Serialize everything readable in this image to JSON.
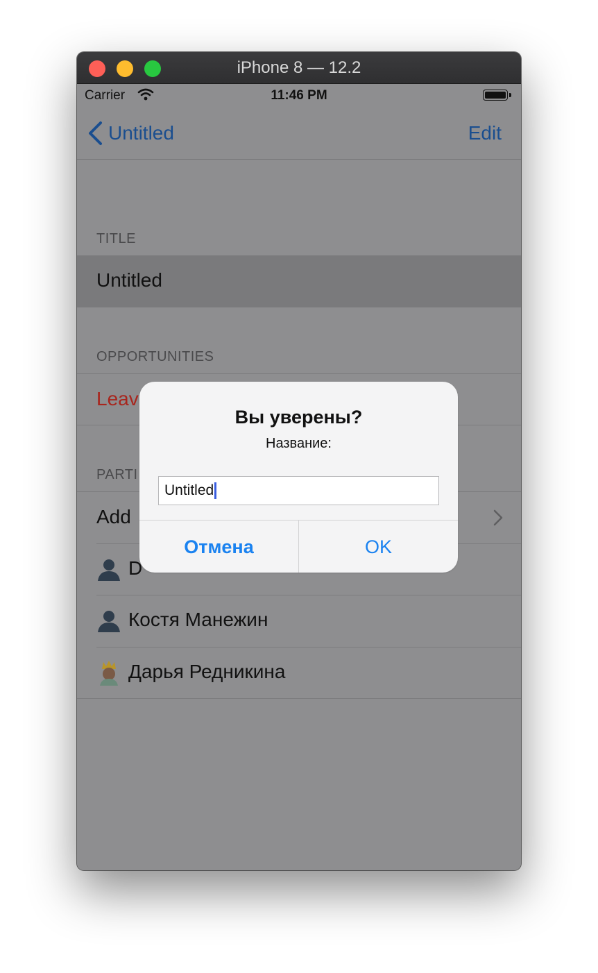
{
  "window": {
    "title": "iPhone 8 — 12.2"
  },
  "status_bar": {
    "carrier": "Carrier",
    "time": "11:46 PM"
  },
  "nav": {
    "back_label": "Untitled",
    "edit_label": "Edit"
  },
  "sections": {
    "title_header": "TITLE",
    "title_value": "Untitled",
    "opportunities_header": "OPPORTUNITIES",
    "leave_chat": "Leave chat",
    "participants_header_visible": "PARTI",
    "add_participant_visible": "Add",
    "participants": [
      {
        "name_visible": "D",
        "icon": "person-icon"
      },
      {
        "name": "Костя Манежин",
        "icon": "person-icon"
      },
      {
        "name": "Дарья Редникина",
        "icon": "crowned-person-icon"
      }
    ]
  },
  "alert": {
    "title": "Вы уверены?",
    "message": "Название:",
    "input_value": "Untitled",
    "cancel_label": "Отмена",
    "ok_label": "OK"
  },
  "colors": {
    "link_blue": "#1a4e8f",
    "destructive_red": "#a8251d",
    "alert_button_blue": "#1a82f0",
    "dim_background": "#8e8e90"
  }
}
